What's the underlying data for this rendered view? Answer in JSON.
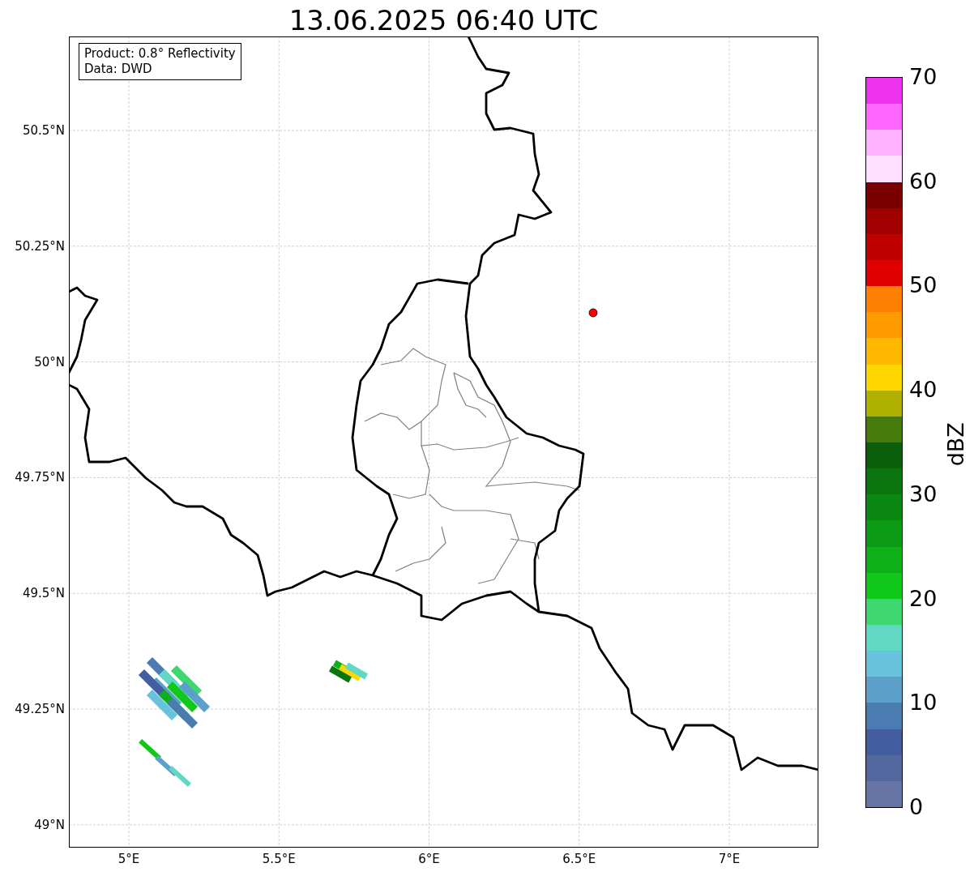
{
  "title": "13.06.2025 06:40 UTC",
  "info_box": {
    "lines": [
      "Product: 0.8° Reflectivity",
      "Data: DWD"
    ]
  },
  "map": {
    "lat_ticks": [
      "50.5°N",
      "50.25°N",
      "50°N",
      "49.75°N",
      "49.5°N",
      "49.25°N",
      "49°N"
    ],
    "lon_ticks": [
      "5°E",
      "5.5°E",
      "6°E",
      "6.5°E",
      "7°E"
    ]
  },
  "colorbar": {
    "label": "dBZ",
    "ticks": [
      "70",
      "60",
      "50",
      "40",
      "30",
      "20",
      "10",
      "0"
    ],
    "segments": [
      {
        "color": "#ee33ee"
      },
      {
        "color": "#ff66ff"
      },
      {
        "color": "#ffb2ff"
      },
      {
        "color": "#ffdeff"
      },
      {
        "color": "#7a0000"
      },
      {
        "color": "#a00000"
      },
      {
        "color": "#c00000"
      },
      {
        "color": "#e00000"
      },
      {
        "color": "#ff8000"
      },
      {
        "color": "#ff9900"
      },
      {
        "color": "#ffb800"
      },
      {
        "color": "#ffd700"
      },
      {
        "color": "#b0b000"
      },
      {
        "color": "#467a0a"
      },
      {
        "color": "#0a5e0a"
      },
      {
        "color": "#0a740e"
      },
      {
        "color": "#0b8812"
      },
      {
        "color": "#0c9a14"
      },
      {
        "color": "#0eb018"
      },
      {
        "color": "#10c81a"
      },
      {
        "color": "#3ed66e"
      },
      {
        "color": "#60d8c4"
      },
      {
        "color": "#68c2dc"
      },
      {
        "color": "#5aa0c8"
      },
      {
        "color": "#4a7cb2"
      },
      {
        "color": "#435ea0"
      },
      {
        "color": "#5468a0"
      },
      {
        "color": "#6674a6"
      }
    ]
  }
}
